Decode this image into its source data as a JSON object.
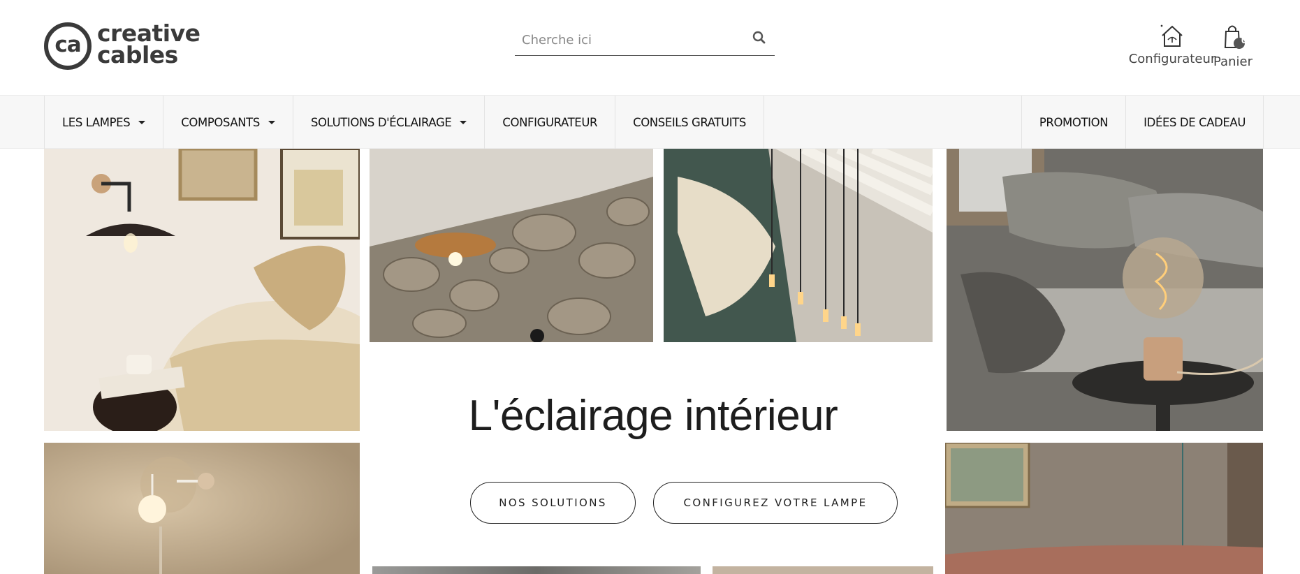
{
  "brand": {
    "mark": "ca",
    "line1": "creative",
    "line2": "cables"
  },
  "search": {
    "placeholder": "Cherche ici"
  },
  "header_actions": {
    "configurator_label": "Configurateur",
    "cart_label": "Panier",
    "cart_count": "0"
  },
  "nav": {
    "items": [
      {
        "label": "LES LAMPES",
        "dropdown": true
      },
      {
        "label": "COMPOSANTS",
        "dropdown": true
      },
      {
        "label": "SOLUTIONS D'ÉCLAIRAGE",
        "dropdown": true
      },
      {
        "label": "CONFIGURATEUR",
        "dropdown": false
      },
      {
        "label": "CONSEILS GRATUITS",
        "dropdown": false
      }
    ],
    "right_items": [
      {
        "label": "PROMOTION"
      },
      {
        "label": "IDÉES DE CADEAU"
      }
    ]
  },
  "hero": {
    "title": "L'éclairage intérieur",
    "buttons": {
      "solutions": "NOS SOLUTIONS",
      "configure": "CONFIGUREZ VOTRE LAMPE"
    }
  },
  "colors": {
    "brand_gray": "#3a3a3a",
    "nav_bg": "#f7f7f7",
    "text_dark": "#1d1d1d"
  }
}
